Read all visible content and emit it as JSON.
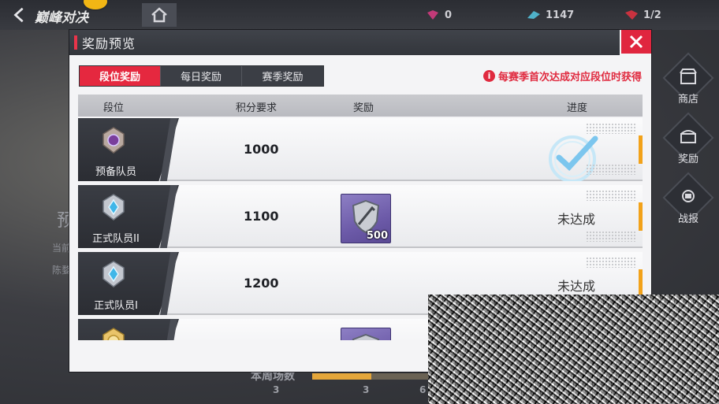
{
  "hud": {
    "mode_title": "巅峰对决",
    "resources": [
      {
        "icon": "gem-icon",
        "value": "0"
      },
      {
        "icon": "feather-token-icon",
        "value": "1147"
      },
      {
        "icon": "ticket-icon",
        "value": "1/2"
      }
    ],
    "side_nav": [
      {
        "icon": "shop-icon",
        "label": "商店"
      },
      {
        "icon": "reward-chest-icon",
        "label": "奖励"
      },
      {
        "icon": "battle-report-icon",
        "label": "战报"
      }
    ],
    "bg_left_texts": [
      "预",
      "当前",
      "陈婺"
    ],
    "bg_bottom": {
      "label": "本周场数",
      "progress_fraction": 0.5,
      "numbers": [
        "3",
        "3",
        "6"
      ]
    }
  },
  "dialog": {
    "title": "奖励预览",
    "close_icon": "close-icon",
    "tabs": [
      {
        "label": "段位奖励",
        "active": true
      },
      {
        "label": "每日奖励",
        "active": false
      },
      {
        "label": "赛季奖励",
        "active": false
      }
    ],
    "hint": {
      "icon": "info-icon",
      "text": "每赛季首次达成对应段位时获得"
    },
    "columns": {
      "rank": "段位",
      "score": "积分要求",
      "reward": "奖励",
      "progress": "进度"
    },
    "rows": [
      {
        "rank_icon": "rank-badge-purple-icon",
        "rank_name": "预备队员",
        "score": "1000",
        "reward": null,
        "status": "",
        "achieved": true
      },
      {
        "rank_icon": "rank-badge-blue-icon",
        "rank_name": "正式队员II",
        "score": "1100",
        "reward": {
          "icon": "shield-sword-icon",
          "qty": "500"
        },
        "status": "未达成",
        "achieved": false
      },
      {
        "rank_icon": "rank-badge-blue-icon",
        "rank_name": "正式队员I",
        "score": "1200",
        "reward": null,
        "status": "未达成",
        "achieved": false
      },
      {
        "rank_icon": "rank-badge-gold-icon",
        "rank_name": "",
        "score": "",
        "reward": {
          "icon": "shield-sword-icon",
          "qty": ""
        },
        "status": "",
        "achieved": false
      }
    ]
  },
  "colors": {
    "accent_red": "#e5283f",
    "header_dark": "#3b3e45",
    "progress_orange": "#f2a21a",
    "check_blue": "#7cc6ee",
    "reward_purple": "#7a69b6"
  }
}
